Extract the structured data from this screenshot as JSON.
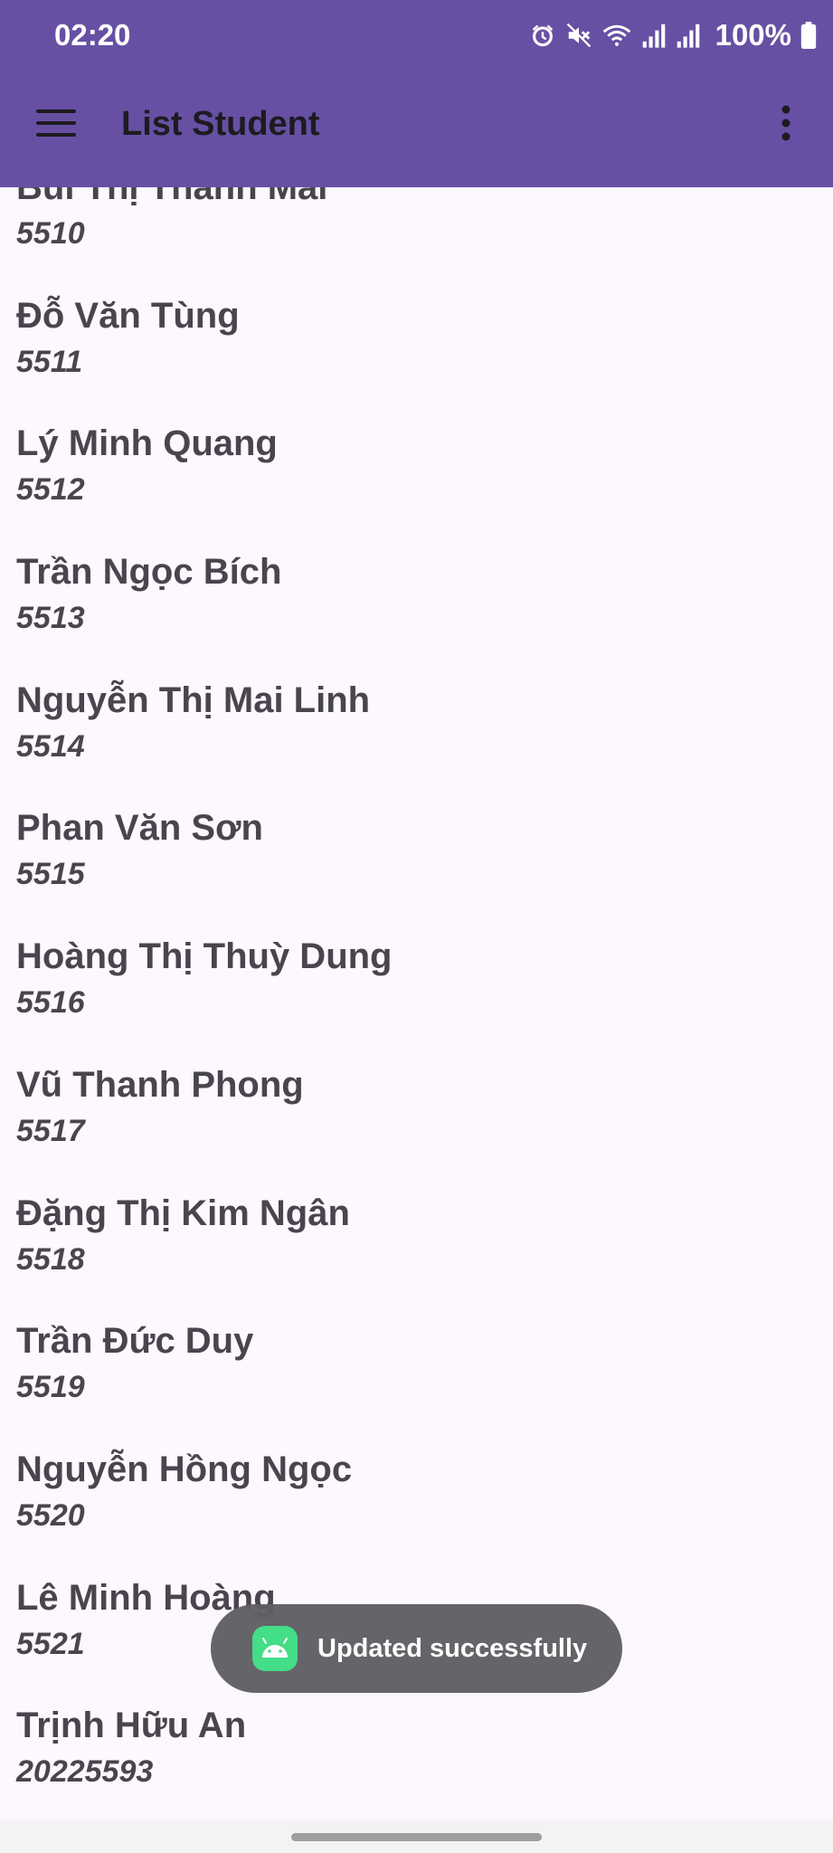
{
  "status_bar": {
    "time": "02:20",
    "battery": "100%",
    "icons": [
      "alarm-icon",
      "mute-icon",
      "wifi-icon",
      "signal-icon",
      "signal-icon",
      "battery-icon"
    ]
  },
  "app_bar": {
    "title": "List Student",
    "menu_icon": "hamburger-menu-icon",
    "overflow_icon": "more-vertical-icon",
    "color": "#6750A4"
  },
  "students": [
    {
      "name": "Bùi Thị Thanh Mai",
      "id": "5510"
    },
    {
      "name": "Đỗ Văn Tùng",
      "id": "5511"
    },
    {
      "name": "Lý Minh Quang",
      "id": "5512"
    },
    {
      "name": "Trần Ngọc Bích",
      "id": "5513"
    },
    {
      "name": "Nguyễn Thị Mai Linh",
      "id": "5514"
    },
    {
      "name": "Phan Văn Sơn",
      "id": "5515"
    },
    {
      "name": "Hoàng Thị Thuỳ Dung",
      "id": "5516"
    },
    {
      "name": "Vũ Thanh Phong",
      "id": "5517"
    },
    {
      "name": "Đặng Thị Kim Ngân",
      "id": "5518"
    },
    {
      "name": "Trần Đức Duy",
      "id": "5519"
    },
    {
      "name": "Nguyễn Hồng Ngọc",
      "id": "5520"
    },
    {
      "name": "Lê Minh Hoàng",
      "id": "5521"
    },
    {
      "name": "Trịnh Hữu An",
      "id": "20225593"
    }
  ],
  "toast": {
    "message": "Updated successfully",
    "icon": "android-icon",
    "icon_color": "#3DDC84"
  }
}
